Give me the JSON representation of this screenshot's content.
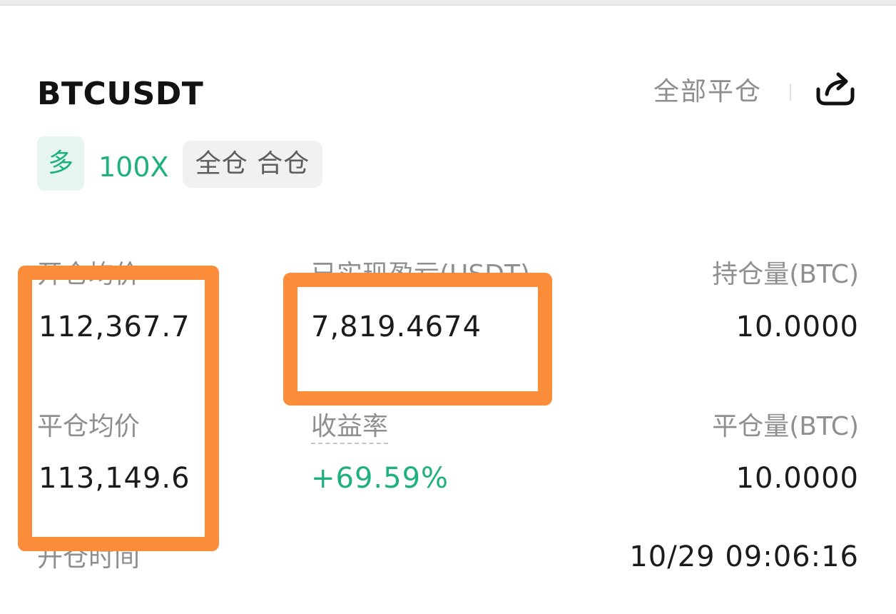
{
  "header": {
    "symbol": "BTCUSDT",
    "close_all_label": "全部平仓",
    "share_icon": "share-icon"
  },
  "tags": {
    "side": "多",
    "leverage": "100X",
    "margin_mode": "全仓 合仓"
  },
  "stats": {
    "open_avg_price": {
      "label": "开仓均价",
      "value": "112,367.7"
    },
    "realized_pnl": {
      "label": "已实现盈亏(USDT)",
      "value": "7,819.4674"
    },
    "position_size": {
      "label": "持仓量(BTC)",
      "value": "10.0000"
    },
    "close_avg_price": {
      "label": "平仓均价",
      "value": "113,149.6"
    },
    "roi": {
      "label": "收益率",
      "value": "+69.59%"
    },
    "closed_size": {
      "label": "平仓量(BTC)",
      "value": "10.0000"
    },
    "open_time": {
      "label": "开仓时间",
      "value": "10/29 09:06:16"
    }
  },
  "colors": {
    "accent_green": "#1fb07f",
    "highlight_orange": "#fb8c3a",
    "text_primary": "#1b1b1b",
    "text_secondary": "#8f8f8f"
  }
}
